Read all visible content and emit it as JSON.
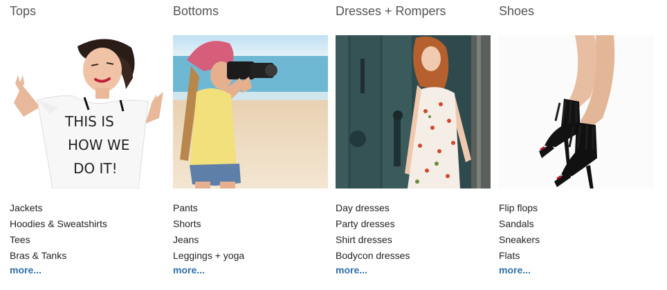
{
  "categories": [
    {
      "title": "Tops",
      "image_alt": "Woman in white tee with black text",
      "shirt_text": [
        "THIS IS",
        "HOW WE",
        "DO IT!"
      ],
      "links": [
        "Jackets",
        "Hoodies & Sweatshirts",
        "Tees",
        "Bras & Tanks"
      ],
      "more": "more..."
    },
    {
      "title": "Bottoms",
      "image_alt": "Woman in shorts with camera at the beach",
      "links": [
        "Pants",
        "Shorts",
        "Jeans",
        "Leggings + yoga"
      ],
      "more": "more..."
    },
    {
      "title": "Dresses + Rompers",
      "image_alt": "Woman in floral dress by old door",
      "links": [
        "Day dresses",
        "Party dresses",
        "Shirt dresses",
        "Bodycon dresses"
      ],
      "more": "more..."
    },
    {
      "title": "Shoes",
      "image_alt": "Legs in black fringe heeled booties",
      "links": [
        "Flip flops",
        "Sandals",
        "Sneakers",
        "Flats"
      ],
      "more": "more..."
    }
  ],
  "colors": {
    "title": "#555555",
    "link_text": "#222222",
    "more_link": "#2f6da8"
  }
}
